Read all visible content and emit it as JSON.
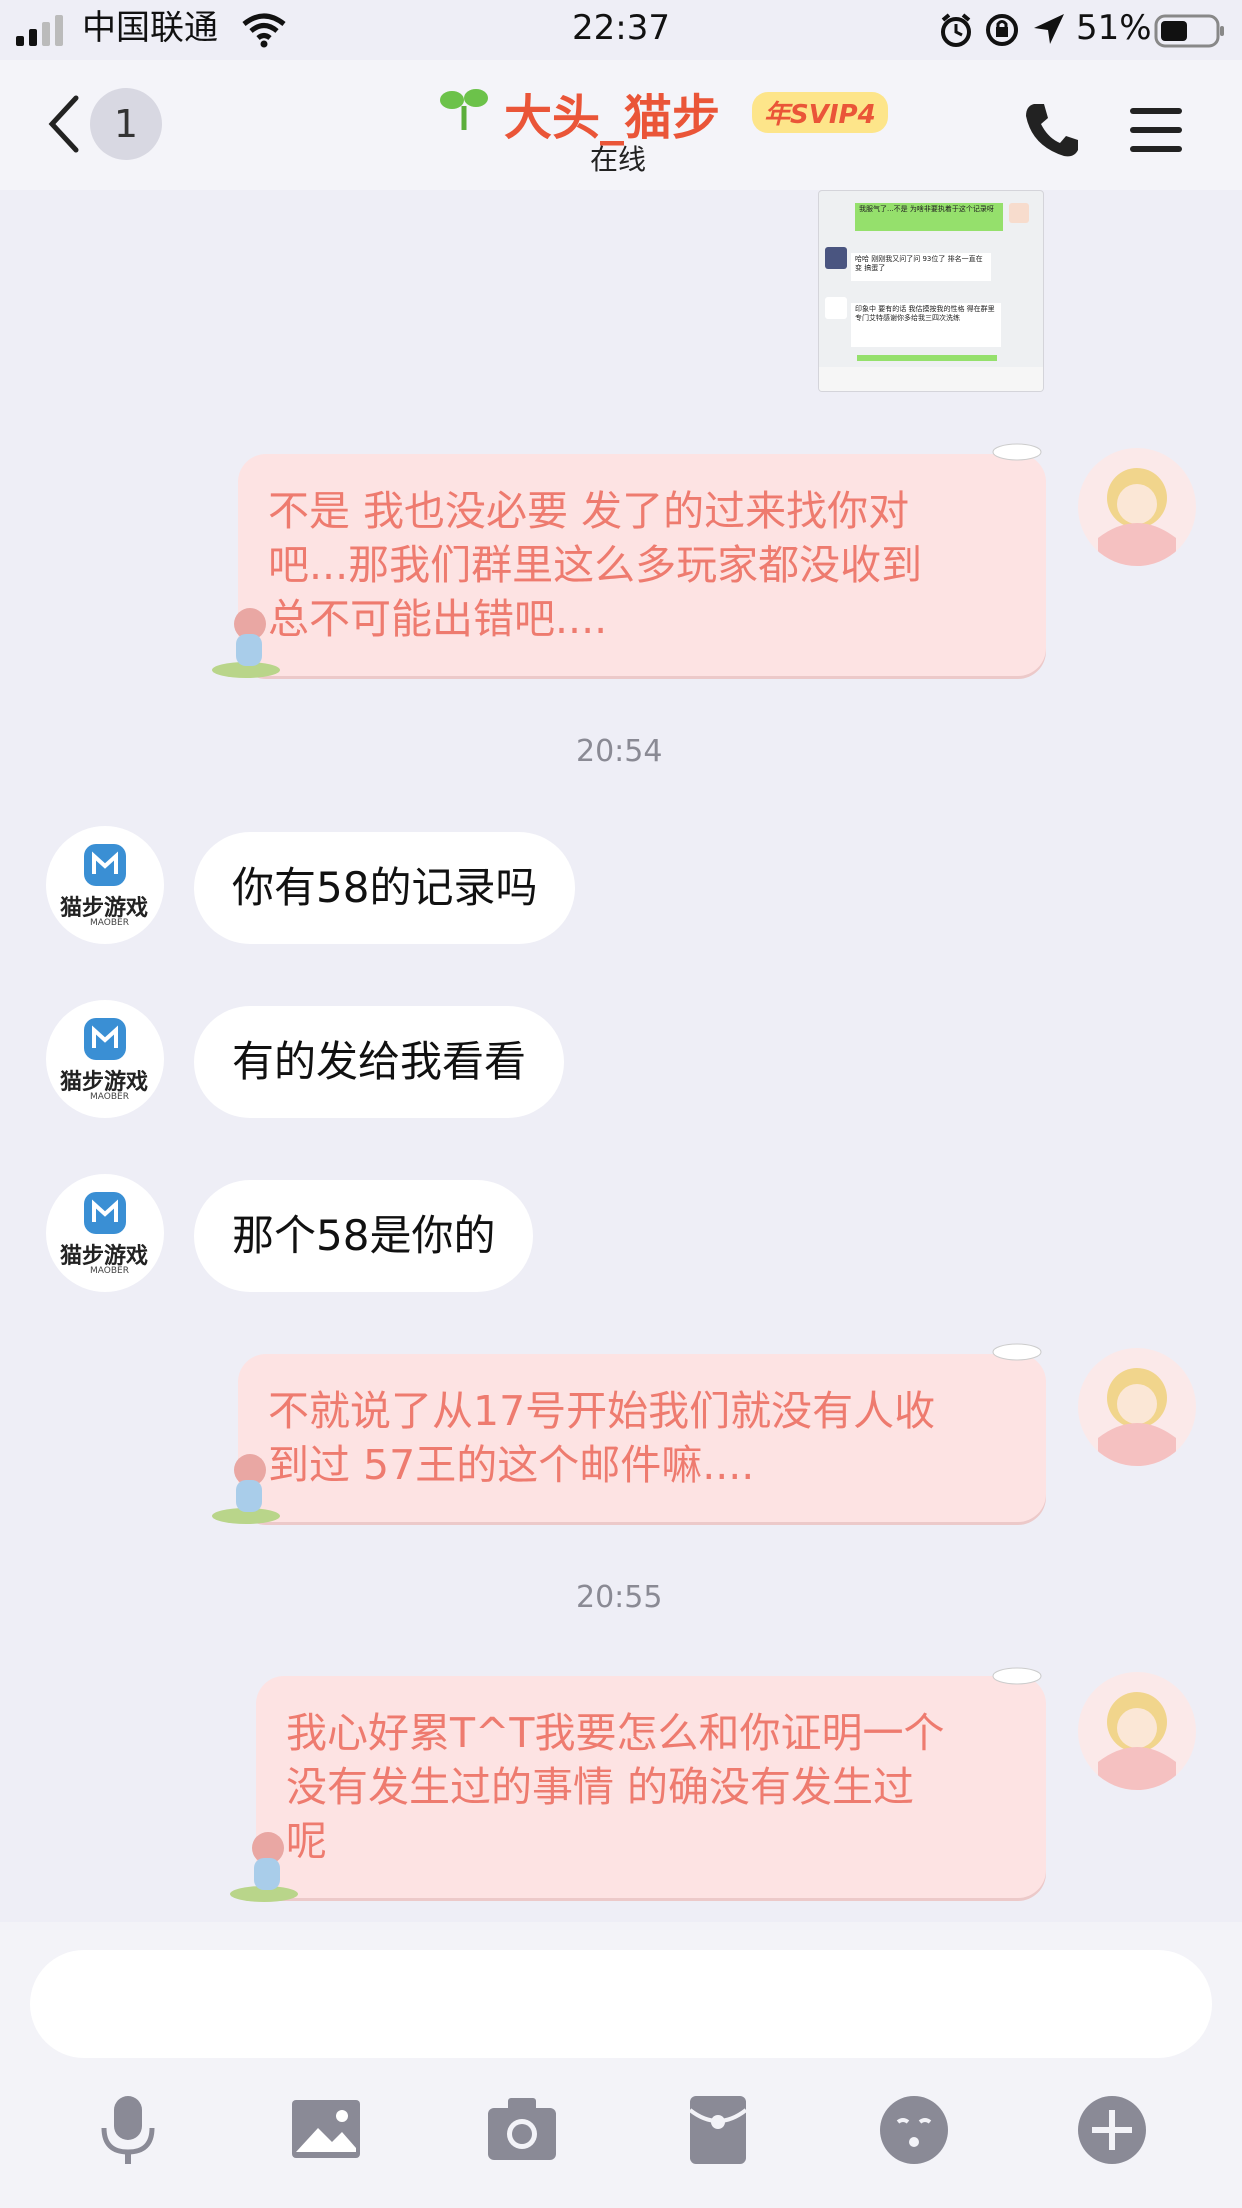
{
  "status_bar": {
    "carrier": "中国联通",
    "time": "22:37",
    "battery": "51%"
  },
  "header": {
    "back_count": "1",
    "title": "大头_猫步",
    "vip_badge": "年SVIP4",
    "status": "在线"
  },
  "screenshot_preview": {
    "line1": "我服气了...不是 为啥非要执着于这个记录呀",
    "line2": "哈哈 刚刚我又问了问 93位了 排名一直在变 搞蛋了",
    "line3": "印象中 要有的话 我估摸按我的性格 得在群里专门艾特感谢你多给我三四次洗练"
  },
  "messages": [
    {
      "side": "right",
      "text": "不是 我也没必要 发了的过来找你对吧...那我们群里这么多玩家都没收到总不可能出错吧...."
    },
    {
      "time": "20:54"
    },
    {
      "side": "left",
      "text": "你有58的记录吗"
    },
    {
      "side": "left",
      "text": "有的发给我看看"
    },
    {
      "side": "left",
      "text": "那个58是你的"
    },
    {
      "side": "right",
      "text": "不就说了从17号开始我们就没有人收到过 57王的这个邮件嘛...."
    },
    {
      "time": "20:55"
    },
    {
      "side": "right",
      "text": "我心好累T^T我要怎么和你证明一个没有发生过的事情 的确没有发生过呢"
    }
  ],
  "msg": {
    "m1_l1": "不是 我也没必要 发了的过来找你对",
    "m1_l2": "吧...那我们群里这么多玩家都没收到",
    "m1_l3": "总不可能出错吧....",
    "t1": "20:54",
    "m2": "你有58的记录吗",
    "m3": "有的发给我看看",
    "m4": "那个58是你的",
    "m5_l1": "不就说了从17号开始我们就没有人收",
    "m5_l2": "到过 57王的这个邮件嘛....",
    "t2": "20:55",
    "m6_l1": "我心好累T^T我要怎么和你证明一个",
    "m6_l2": "没有发生过的事情 的确没有发生过",
    "m6_l3": "呢"
  },
  "game_avatar": {
    "brand": "猫步游戏",
    "sub": "MAOBER"
  },
  "toolbar": [
    "microphone-icon",
    "image-icon",
    "camera-icon",
    "red-packet-icon",
    "emoji-icon",
    "plus-icon"
  ]
}
